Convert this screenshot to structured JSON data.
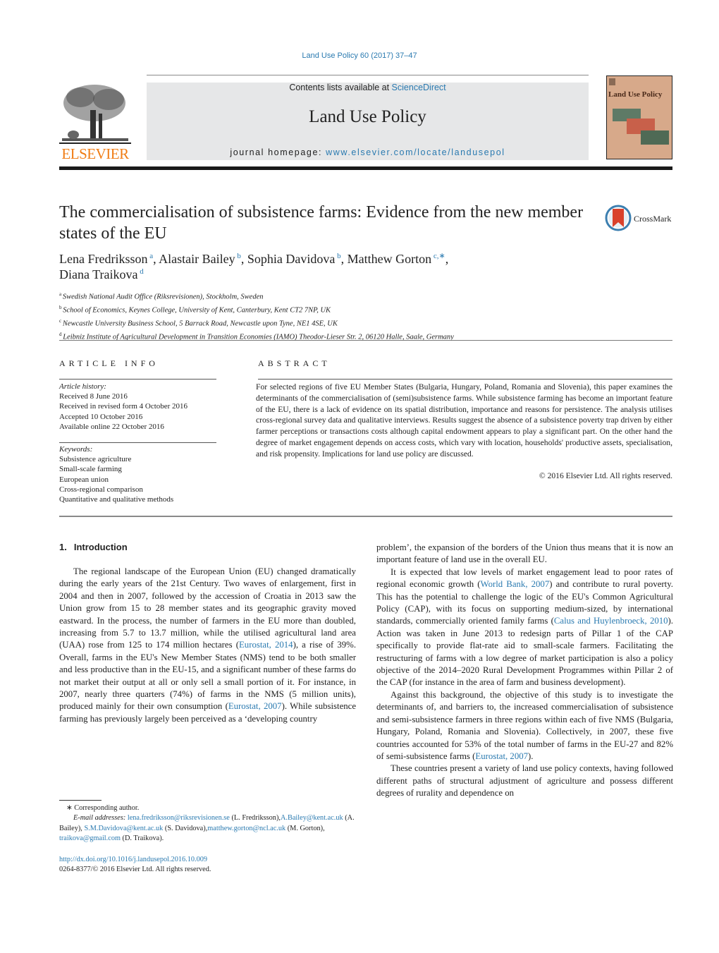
{
  "header": {
    "journal_citation": "Land Use Policy 60 (2017) 37–47",
    "contents_prefix": "Contents lists available at ",
    "contents_link": "ScienceDirect",
    "journal_name": "Land Use Policy",
    "homepage_prefix": "journal homepage: ",
    "homepage_url": "www.elsevier.com/locate/landusepol",
    "publisher_logo": "ELSEVIER",
    "cover_title": "Land Use Policy",
    "crossmark_label": "CrossMark"
  },
  "article": {
    "title": "The commercialisation of subsistence farms: Evidence from the new member states of the EU",
    "authors": [
      {
        "name": "Lena Fredriksson",
        "sup": "a",
        "sep": ", "
      },
      {
        "name": "Alastair Bailey",
        "sup": "b",
        "sep": ", "
      },
      {
        "name": "Sophia Davidova",
        "sup": "b",
        "sep": ", "
      },
      {
        "name": "Matthew Gorton",
        "sup": "c,∗",
        "sep": ","
      },
      {
        "name": "Diana Traikova",
        "sup": "d",
        "sep": ""
      }
    ],
    "affiliations": [
      {
        "sup": "a",
        "text": "Swedish National Audit Office (Riksrevisionen), Stockholm, Sweden"
      },
      {
        "sup": "b",
        "text": "School of Economics, Keynes College, University of Kent, Canterbury, Kent CT2 7NP, UK"
      },
      {
        "sup": "c",
        "text": "Newcastle University Business School, 5 Barrack Road, Newcastle upon Tyne, NE1 4SE, UK"
      },
      {
        "sup": "d",
        "text": "Leibniz Institute of Agricultural Development in Transition Economies (IAMO) Theodor-Lieser Str. 2, 06120 Halle, Saale, Germany"
      }
    ]
  },
  "article_info": {
    "heading": "ARTICLE INFO",
    "history_label": "Article history:",
    "history": [
      "Received 8 June 2016",
      "Received in revised form 4 October 2016",
      "Accepted 10 October 2016",
      "Available online 22 October 2016"
    ],
    "keywords_label": "Keywords:",
    "keywords": [
      "Subsistence agriculture",
      "Small-scale farming",
      "European union",
      "Cross-regional comparison",
      "Quantitative and qualitative methods"
    ]
  },
  "abstract": {
    "heading": "ABSTRACT",
    "text": "For selected regions of five EU Member States (Bulgaria, Hungary, Poland, Romania and Slovenia), this paper examines the determinants of the commercialisation of (semi)subsistence farms. While subsistence farming has become an important feature of the EU, there is a lack of evidence on its spatial distribution, importance and reasons for persistence. The analysis utilises cross-regional survey data and qualitative interviews. Results suggest the absence of a subsistence poverty trap driven by either farmer perceptions or transactions costs although capital endowment appears to play a significant part. On the other hand the degree of market engagement depends on access costs, which vary with location, households' productive assets, specialisation, and risk propensity. Implications for land use policy are discussed.",
    "copyright": "© 2016 Elsevier Ltd. All rights reserved."
  },
  "body": {
    "section_number": "1.",
    "section_title": "Introduction",
    "p1": [
      {
        "t": "The regional landscape of the European Union (EU) changed dramatically during the early years of the 21st Century. Two waves of enlargement, first in 2004 and then in 2007, followed by the accession of Croatia in 2013 saw the Union grow from 15 to 28 member states and its geographic gravity moved eastward. In the process, the number of farmers in the EU more than doubled, increasing from 5.7 to 13.7 million, while the utilised agricultural land area (UAA) rose from 125 to 174 million hectares ("
      },
      {
        "t": "Eurostat, 2014",
        "link": true
      },
      {
        "t": "), a rise of 39%. Overall, farms in the EU's New Member States (NMS) tend to be both smaller and less productive than in the EU-15, and a significant number of these farms do not market their output at all or only sell a small portion of it. For instance, in 2007, nearly three quarters (74%) of farms in the NMS (5 million units), produced mainly for their own consumption ("
      },
      {
        "t": "Eurostat, 2007",
        "link": true
      },
      {
        "t": "). While subsistence farming has previously largely been perceived as a ‘developing country"
      }
    ],
    "p1_cont": "problem’, the expansion of the borders of the Union thus means that it is now an important feature of land use in the overall EU.",
    "p2": [
      {
        "t": "It is expected that low levels of market engagement lead to poor rates of regional economic growth ("
      },
      {
        "t": "World Bank, 2007",
        "link": true
      },
      {
        "t": ") and contribute to rural poverty. This has the potential to challenge the logic of the EU's Common Agricultural Policy (CAP), with its focus on supporting medium-sized, by international standards, commercially oriented family farms ("
      },
      {
        "t": "Calus and Huylenbroeck, 2010",
        "link": true
      },
      {
        "t": "). Action was taken in June 2013 to redesign parts of Pillar 1 of the CAP specifically to provide flat-rate aid to small-scale farmers. Facilitating the restructuring of farms with a low degree of market participation is also a policy objective of the 2014–2020 Rural Development Programmes within Pillar 2 of the CAP (for instance in the area of farm and business development)."
      }
    ],
    "p3": [
      {
        "t": "Against this background, the objective of this study is to investigate the determinants of, and barriers to, the increased commercialisation of subsistence and semi-subsistence farmers in three regions within each of five NMS (Bulgaria, Hungary, Poland, Romania and Slovenia). Collectively, in 2007, these five countries accounted for 53% of the total number of farms in the EU-27 and 82% of semi-subsistence farms ("
      },
      {
        "t": "Eurostat, 2007",
        "link": true
      },
      {
        "t": ")."
      }
    ],
    "p4": "These countries present a variety of land use policy contexts, having followed different paths of structural adjustment of agriculture and possess different degrees of rurality and dependence on"
  },
  "footnotes": {
    "corresponding": "∗  Corresponding author.",
    "email_label": "E-mail addresses:",
    "emails": [
      {
        "email": "lena.fredriksson@riksrevisionen.se",
        "who": " (L. Fredriksson),"
      },
      {
        "email": "A.Bailey@kent.ac.uk",
        "who": " (A. Bailey), "
      },
      {
        "email": "S.M.Davidova@kent.ac.uk",
        "who": " (S. Davidova),"
      },
      {
        "email": "matthew.gorton@ncl.ac.uk",
        "who": " (M. Gorton), "
      },
      {
        "email": "traikova@gmail.com",
        "who": " (D. Traikova)."
      }
    ],
    "doi": "http://dx.doi.org/10.1016/j.landusepol.2016.10.009",
    "issn": "0264-8377/© 2016 Elsevier Ltd. All rights reserved."
  }
}
